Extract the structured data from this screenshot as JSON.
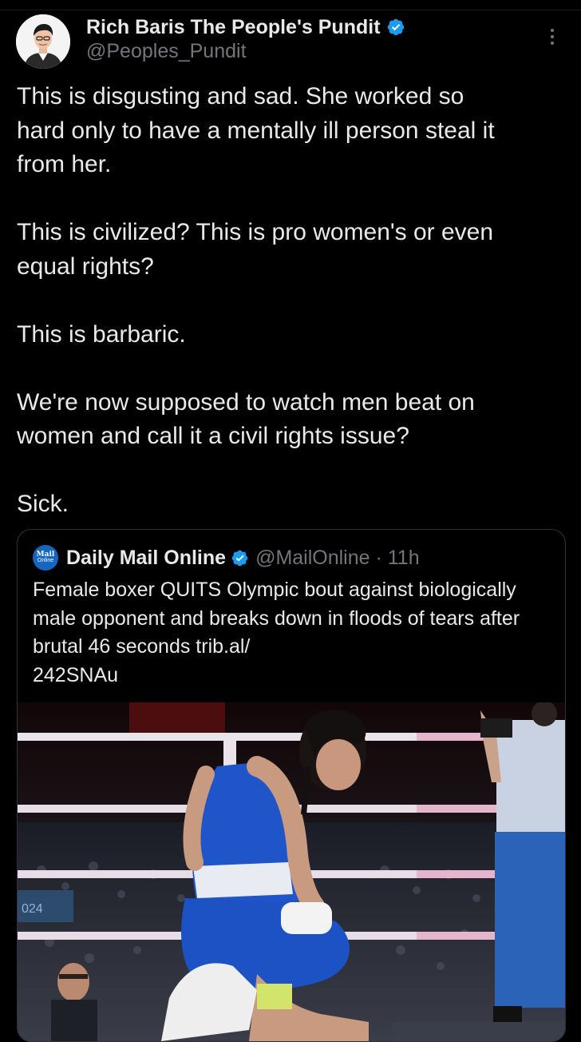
{
  "post": {
    "author_name": "Rich Baris The People's Pundit",
    "author_handle": "@Peoples_Pundit",
    "paragraphs": [
      "This is disgusting and sad. She worked so\nhard only to have a mentally ill person steal it\nfrom her.",
      "This is civilized? This is pro women's or even\nequal rights?",
      "This is barbaric.",
      "We're now supposed to watch men beat on\nwomen and call it a civil rights issue?",
      "Sick."
    ]
  },
  "quoted_post": {
    "logo_line1": "Mail",
    "logo_line2": "Online",
    "author_name": "Daily Mail Online",
    "handle_time": "@MailOnline · 11h",
    "text": "Female boxer QUITS Olympic bout against biologically male opponent and breaks down in floods of tears after brutal 46 seconds trib.al/\n242SNAu"
  },
  "colors": {
    "background": "#000000",
    "text_primary": "#e7e9ea",
    "text_secondary": "#71767b",
    "verified_badge": "#1d9bf0",
    "border": "#2f3336",
    "boxer_uniform": "#1f55c8"
  },
  "icons": [
    "verified-badge-icon",
    "more-options-icon",
    "mail-online-logo"
  ]
}
